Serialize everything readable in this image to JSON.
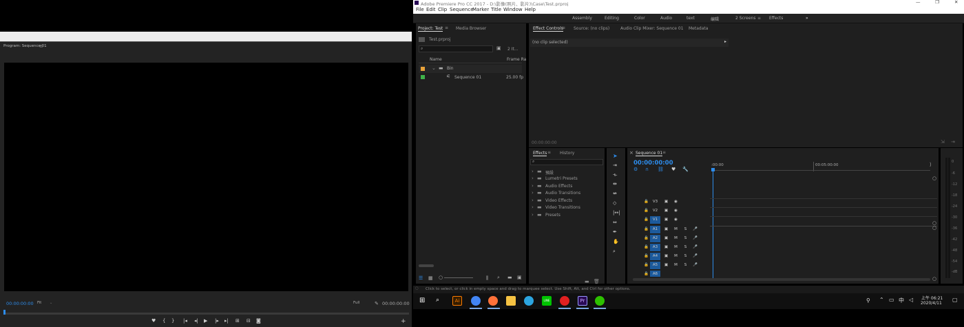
{
  "program_monitor": {
    "title": "Program: Sequence 01",
    "timecode_left": "00:00:00:00",
    "fit": "Fit",
    "quality": "Full",
    "timecode_right": "00:00:00:00"
  },
  "window": {
    "title": "Adobe Premiere Pro CC 2017 - D:\\影像(照片、影片)\\Case\\Test.prproj"
  },
  "menu": [
    "File",
    "Edit",
    "Clip",
    "Sequence",
    "Marker",
    "Title",
    "Window",
    "Help"
  ],
  "workspaces": [
    "Assembly",
    "Editing",
    "Color",
    "Audio",
    "text",
    "编辑",
    "2 Screens",
    "Effects"
  ],
  "project": {
    "tab": "Project: Test",
    "tab2": "Media Browser",
    "file": "Test.prproj",
    "item_count": "2 It...",
    "col_name": "Name",
    "col_frame": "Frame Ra",
    "rows": [
      {
        "name": "Bin",
        "color": "#e8a23a",
        "rate": ""
      },
      {
        "name": "Sequence 01",
        "color": "#3fb24a",
        "rate": "25.00 fp"
      }
    ]
  },
  "effect_controls": {
    "tab": "Effect Controls",
    "tab2": "Source: (no clips)",
    "tab3": "Audio Clip Mixer: Sequence 01",
    "tab4": "Metadata",
    "no_clip": "(no clip selected)",
    "timecode": "00:00:00:00"
  },
  "effects": {
    "tab": "Effects",
    "tab2": "History",
    "items": [
      "預設",
      "Lumetri Presets",
      "Audio Effects",
      "Audio Transitions",
      "Video Effects",
      "Video Transitions",
      "Presets"
    ]
  },
  "timeline": {
    "tab": "Sequence 01",
    "timecode": "00:00:00:00",
    "ruler_start": ":00:00",
    "ruler_mid": "00:05:00:00",
    "video_tracks": [
      "V3",
      "V2",
      "V1"
    ],
    "audio_tracks": [
      "A1",
      "A2",
      "A3",
      "A4",
      "A5",
      "A6"
    ],
    "mute": "M",
    "solo": "S"
  },
  "meter_labels": [
    "0",
    "-6",
    "-12",
    "-18",
    "-24",
    "-30",
    "-36",
    "-42",
    "-48",
    "-54",
    "-dB"
  ],
  "status": "Click to select, or click in empty space and drag to marquee select. Use Shift, Alt, and Ctrl for other options.",
  "taskbar": {
    "time": "上午 06:21",
    "date": "2020/4/11",
    "ime": "中",
    "apps": [
      {
        "name": "illustrator",
        "color": "#ff7c00",
        "label": "Ai"
      },
      {
        "name": "chrome",
        "color": "#4285f4",
        "label": ""
      },
      {
        "name": "firefox",
        "color": "#ff7139",
        "label": ""
      },
      {
        "name": "explorer",
        "color": "#f5c242",
        "label": ""
      },
      {
        "name": "telegram",
        "color": "#2ca5e0",
        "label": ""
      },
      {
        "name": "line",
        "color": "#00c300",
        "label": "LINE"
      },
      {
        "name": "app-red",
        "color": "#e02020",
        "label": ""
      },
      {
        "name": "premiere",
        "color": "#2a0a55",
        "label": "Pr"
      },
      {
        "name": "wechat",
        "color": "#2dc100",
        "label": ""
      }
    ]
  }
}
